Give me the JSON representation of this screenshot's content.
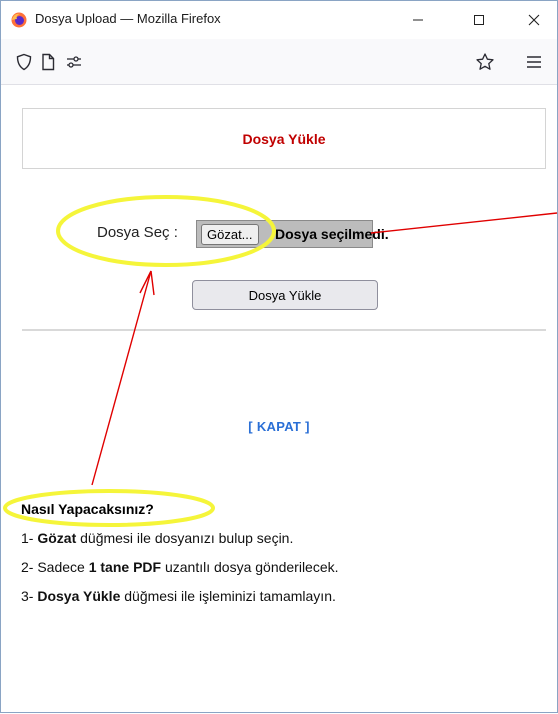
{
  "window": {
    "title": "Dosya Upload — Mozilla Firefox",
    "minimize_glyph": "—",
    "maximize_glyph": "☐",
    "close_glyph": "✕"
  },
  "toolbar": {
    "icons": [
      "shield-icon",
      "page-icon",
      "permissions-icon",
      "bookmark-star-icon",
      "menu-icon"
    ]
  },
  "page": {
    "upload_title": "Dosya Yükle",
    "file_label": "Dosya Seç :",
    "browse_button": "Gözat...",
    "no_file_text": "Dosya seçilmedi.",
    "submit_button": "Dosya Yükle",
    "close_link": "[ KAPAT ]",
    "howto": {
      "title": "Nasıl Yapacaksınız?",
      "steps": [
        {
          "prefix": "1- ",
          "bold": "Gözat",
          "rest": " düğmesi ile dosyanızı bulup seçin."
        },
        {
          "prefix": "2- Sadece ",
          "bold": "1 tane PDF",
          "rest": " uzantılı dosya gönderilecek."
        },
        {
          "prefix": "3- ",
          "bold": "Dosya Yükle",
          "rest": " düğmesi ile işleminizi tamamlayın."
        }
      ]
    }
  },
  "colors": {
    "title_red": "#c00000",
    "link_blue": "#2a6fd6",
    "highlight_yellow": "#f5f53a",
    "arrow_red": "#e00000"
  }
}
